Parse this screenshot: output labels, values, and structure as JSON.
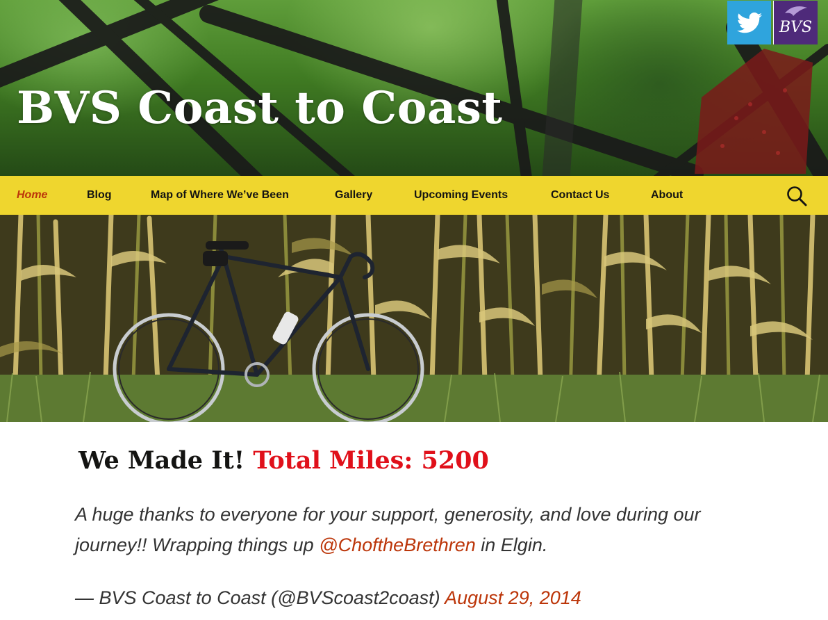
{
  "site": {
    "title": "BVS Coast to Coast"
  },
  "social": {
    "twitter_icon": "twitter-bird-icon",
    "bvs_label": "BVS",
    "twitter_color": "#2fa4dd",
    "bvs_color": "#4e2a7a"
  },
  "nav": {
    "items": [
      {
        "label": "Home",
        "active": true
      },
      {
        "label": "Blog"
      },
      {
        "label": "Map of Where We’ve Been"
      },
      {
        "label": "Gallery"
      },
      {
        "label": "Upcoming Events"
      },
      {
        "label": "Contact Us"
      },
      {
        "label": "About"
      }
    ],
    "search_icon": "search-icon",
    "bar_color": "#efd62e",
    "active_color": "#bc360a"
  },
  "post": {
    "title_prefix": "We Made It!",
    "title_highlight": "Total Miles: 5200",
    "quote_text": "A huge thanks to everyone for your support, generosity, and love during our journey!! Wrapping things up",
    "quote_mention": "@ChoftheBrethren",
    "quote_suffix": "in Elgin.",
    "attribution_text": "— BVS Coast to Coast (@BVScoast2coast)",
    "attribution_date": "August 29, 2014"
  }
}
